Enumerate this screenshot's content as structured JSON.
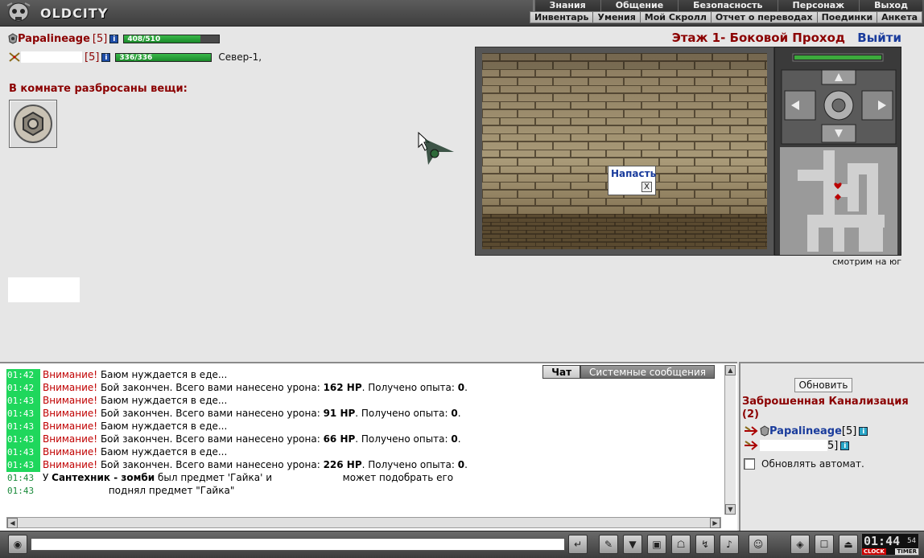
{
  "app": {
    "brand": "OLDCITY"
  },
  "menu": {
    "row1": [
      "Знания",
      "Общение",
      "Безопасность",
      "Персонаж",
      "Выход"
    ],
    "row2": [
      "Инвентарь",
      "Умения",
      "Мой Скролл",
      "Отчет о переводах",
      "Поединки",
      "Анкета"
    ]
  },
  "players": [
    {
      "name": "Papalineage",
      "level": "[5]",
      "hp_text": "408/510",
      "hp_fraction": 0.8
    },
    {
      "name": "",
      "level": "[5]",
      "hp_text": "336/336",
      "hp_fraction": 1.0,
      "location": "Север-1,"
    }
  ],
  "room": {
    "scatter_label": "В комнате разбросаны вещи:",
    "location_title": "Этаж 1- Боковой Проход",
    "exit_label": "Выйти",
    "compass_text": "смотрим на юг",
    "popup_action": "Напасть",
    "popup_close": "X"
  },
  "chat": {
    "tabs": [
      "Чат",
      "Системные сообщения"
    ],
    "lines": [
      {
        "time": "01:42",
        "kind": "warn",
        "prefix": "Внимание!",
        "text": "Баюм нуждается в еде..."
      },
      {
        "time": "01:42",
        "kind": "battle",
        "prefix": "Внимание!",
        "text": "Бой закончен. Всего вами нанесено урона: ",
        "dmg": "162 HP",
        "tail": ". Получено опыта: ",
        "exp": "0",
        "end": "."
      },
      {
        "time": "01:43",
        "kind": "warn",
        "prefix": "Внимание!",
        "text": "Баюм нуждается в еде..."
      },
      {
        "time": "01:43",
        "kind": "battle",
        "prefix": "Внимание!",
        "text": "Бой закончен. Всего вами нанесено урона: ",
        "dmg": "91 HP",
        "tail": ". Получено опыта: ",
        "exp": "0",
        "end": "."
      },
      {
        "time": "01:43",
        "kind": "warn",
        "prefix": "Внимание!",
        "text": "Баюм нуждается в еде..."
      },
      {
        "time": "01:43",
        "kind": "battle",
        "prefix": "Внимание!",
        "text": "Бой закончен. Всего вами нанесено урона: ",
        "dmg": "66 HP",
        "tail": ". Получено опыта: ",
        "exp": "0",
        "end": "."
      },
      {
        "time": "01:43",
        "kind": "warn",
        "prefix": "Внимание!",
        "text": "Баюм нуждается в еде..."
      },
      {
        "time": "01:43",
        "kind": "battle",
        "prefix": "Внимание!",
        "text": "Бой закончен. Всего вами нанесено урона: ",
        "dmg": "226 HP",
        "tail": ". Получено опыта: ",
        "exp": "0",
        "end": "."
      },
      {
        "time": "01:43",
        "kind": "loot",
        "a": "У ",
        "who": "Сантехник - зомби",
        "b": " был предмет 'Гайка' и ",
        "c": " может подобрать его"
      },
      {
        "time": "01:43",
        "kind": "pickup",
        "text": "поднял предмет \"Гайка\""
      }
    ]
  },
  "side": {
    "refresh_label": "Обновить",
    "room_name": "Заброшенная Канализация (2)",
    "players": [
      {
        "name": "Papalineage",
        "level": "[5]"
      },
      {
        "name": "",
        "level": "5]"
      }
    ],
    "auto_refresh_label": "Обновлять автомат."
  },
  "clock": {
    "time": "01:44",
    "seconds": "54",
    "clock_label": "CLOCK",
    "timer_label": "TIMER"
  },
  "toolbar_icons": [
    "enter-icon",
    "eraser-icon",
    "filter-icon",
    "save-icon",
    "run-icon",
    "pvp-icon",
    "sound-icon",
    "smile-icon",
    "bag-icon",
    "lock-icon",
    "exit-icon"
  ],
  "exit_small_label": "EXIT"
}
